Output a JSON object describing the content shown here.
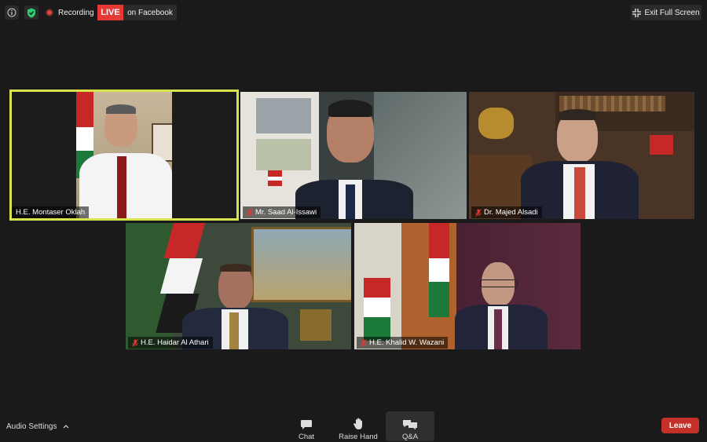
{
  "topbar": {
    "recording_label": "Recording",
    "live_label": "LIVE",
    "live_platform": "on Facebook",
    "exit_fullscreen_label": "Exit Full Screen"
  },
  "participants": [
    {
      "name": "H.E. Montaser Oklah",
      "active_speaker": true,
      "muted": false
    },
    {
      "name": "Mr. Saad Al-Issawi",
      "active_speaker": false,
      "muted": true
    },
    {
      "name": "Dr. Majed Alsadi",
      "active_speaker": false,
      "muted": true
    },
    {
      "name": "H.E. Haidar Al Athari",
      "active_speaker": false,
      "muted": true
    },
    {
      "name": "H.E. Khalid W. Wazani",
      "active_speaker": false,
      "muted": true
    }
  ],
  "bottombar": {
    "audio_settings_label": "Audio Settings",
    "chat_label": "Chat",
    "raise_hand_label": "Raise Hand",
    "qa_label": "Q&A",
    "leave_label": "Leave"
  },
  "colors": {
    "background": "#1a1a1a",
    "live_red": "#e53935",
    "active_speaker_border": "#d6e34f",
    "leave_red": "#c6302b",
    "security_green": "#2ecc71"
  },
  "icons": [
    "info-icon",
    "shield-check-icon",
    "recording-icon",
    "fullscreen-exit-icon",
    "mic-off-icon",
    "chat-icon",
    "raise-hand-icon",
    "qa-icon",
    "chevron-up-icon"
  ]
}
